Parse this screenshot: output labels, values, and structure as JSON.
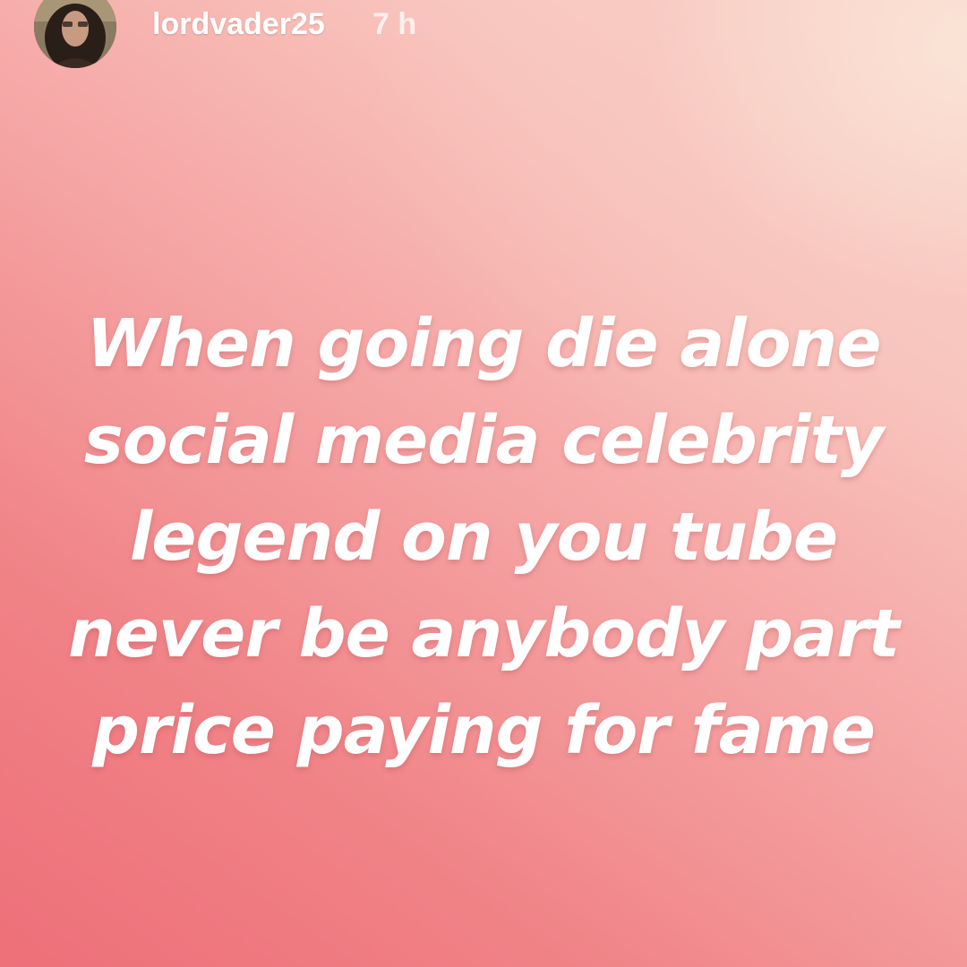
{
  "story": {
    "username": "lordvader25",
    "timestamp": "7 h",
    "avatar_icon": "profile-avatar-image",
    "background_colors": [
      "#ee6f79",
      "#f5a3a3",
      "#fadfd3"
    ],
    "text_color": "#ffffff",
    "lines": [
      "When going die alone",
      "social media celebrity",
      "legend on you tube",
      "never be anybody part",
      "price paying for fame"
    ]
  }
}
